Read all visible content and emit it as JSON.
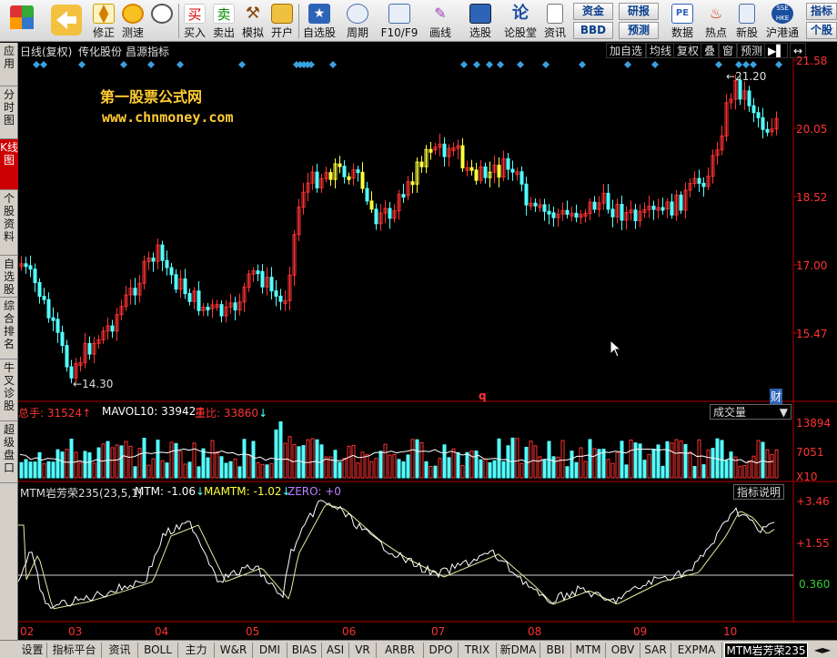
{
  "toolbar": {
    "buttons": [
      {
        "label": "",
        "icon": "grid-icon"
      },
      {
        "label": "",
        "icon": "back-arrow-icon"
      },
      {
        "label": "修正",
        "icon": "up-down-arrows-icon"
      },
      {
        "label": "测速",
        "icon": "speed-icon"
      },
      {
        "label": "",
        "icon": "clock-icon"
      },
      {
        "label": "买入",
        "icon": "buy-icon"
      },
      {
        "label": "卖出",
        "icon": "sell-icon"
      },
      {
        "label": "模拟",
        "icon": "hammer-icon"
      },
      {
        "label": "开户",
        "icon": "lock-icon"
      },
      {
        "label": "自选股",
        "icon": "star-icon"
      },
      {
        "label": "周期",
        "icon": "cycle-icon"
      },
      {
        "label": "F10/F9",
        "icon": "f10-icon"
      },
      {
        "label": "画线",
        "icon": "pen-icon"
      },
      {
        "label": "选股",
        "icon": "stock-select-icon"
      },
      {
        "label": "论股堂",
        "icon": "lun-icon"
      },
      {
        "label": "资讯",
        "icon": "doc-icon"
      },
      {
        "label": "数据",
        "icon": "pe-icon"
      },
      {
        "label": "热点",
        "icon": "fire-icon"
      },
      {
        "label": "新股",
        "icon": "ipo-icon"
      },
      {
        "label": "沪港通",
        "icon": "sse-hkex-icon"
      }
    ],
    "small_buttons": [
      "资金",
      "研报",
      "BBD",
      "预测",
      "指标",
      "个股"
    ]
  },
  "left_tabs": [
    "应用",
    "分时图",
    "K线图",
    "个股资料",
    "自选股",
    "综合排名",
    "牛叉诊股",
    "超级盘口"
  ],
  "main": {
    "header": {
      "period": "日线(复权)",
      "stock": "传化股份",
      "indicator": "昌源指标"
    },
    "top_buttons": [
      "加自选",
      "均线",
      "复权",
      "叠",
      "窗",
      "预测"
    ],
    "watermark_line1": "第一股票公式网",
    "watermark_line2": "www.chnmoney.com",
    "high_label": "21.20",
    "low_label": "14.30",
    "marker_q": "q",
    "marker_cai": "财",
    "price_axis": [
      "21.58",
      "20.05",
      "18.52",
      "17.00",
      "15.47"
    ]
  },
  "volume": {
    "label_total": "总手:",
    "total": "31524",
    "label_mavol": "MAVOL10:",
    "mavol": "33942",
    "label_ratio": "量比:",
    "ratio": "33860",
    "dropdown": "成交量",
    "axis": [
      "13894",
      "7051",
      "X10"
    ]
  },
  "mtm": {
    "title": "MTM岩芳荣235(23,5,1)",
    "mtm_label": "MTM:",
    "mtm_value": "-1.06",
    "mamtm_label": "MAMTM:",
    "mamtm_value": "-1.02",
    "zero_label": "ZERO:",
    "zero_value": "+0",
    "explain_button": "指标说明",
    "axis": [
      "+3.46",
      "+1.55",
      "0.360"
    ]
  },
  "months": [
    "02",
    "03",
    "04",
    "05",
    "06",
    "07",
    "08",
    "09",
    "10"
  ],
  "bottom_tabs": [
    "设置",
    "指标平台",
    "资讯",
    "BOLL",
    "主力",
    "W&R",
    "DMI",
    "BIAS",
    "ASI",
    "VR",
    "ARBR",
    "DPO",
    "TRIX",
    "新DMA",
    "BBI",
    "MTM",
    "OBV",
    "SAR",
    "EXPMA",
    "MTM岩芳荣235"
  ],
  "colors": {
    "up": "#ff3232",
    "down": "#54ffff",
    "axis_red": "#b00000",
    "mtm_line": "#ffffff",
    "mamtm_line": "#e8e8a0",
    "zero_line": "#d0d0d0",
    "highlight": "#ffff40"
  }
}
